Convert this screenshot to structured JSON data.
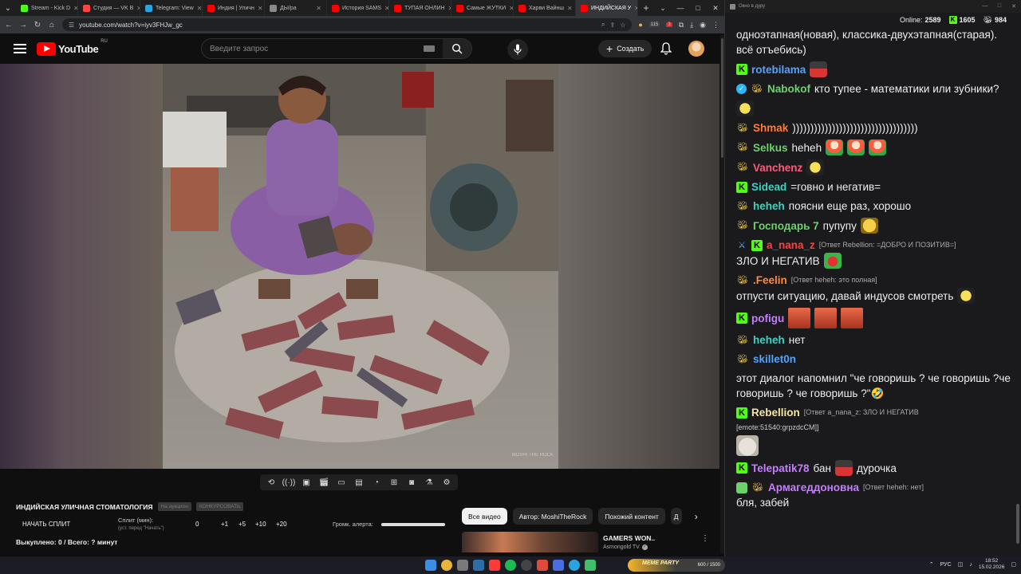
{
  "browser": {
    "tabs": [
      {
        "title": "Stream - Kick D",
        "color": "#53fc18"
      },
      {
        "title": "Студия — VK В",
        "color": "#ff4444"
      },
      {
        "title": "Telegram: View",
        "color": "#2aa3e0"
      },
      {
        "title": "Индия | Уличн",
        "color": "#ff0000"
      },
      {
        "title": "ДЫ/pa",
        "color": "#8a8a8a"
      },
      {
        "title": "История SAMS",
        "color": "#ff0000"
      },
      {
        "title": "ТУПАЯ ОНЛИН",
        "color": "#ff0000"
      },
      {
        "title": "Самые ЖУТКИ",
        "color": "#ff0000"
      },
      {
        "title": "Харви Вайнш",
        "color": "#ff0000"
      },
      {
        "title": "ИНДИЙСКАЯ У",
        "color": "#ff0000"
      }
    ],
    "url": "youtube.com/watch?v=iyv3FHJw_gc",
    "ext_badge_1": "115",
    "ext_badge_2": "3"
  },
  "youtube": {
    "logo_word": "YouTube",
    "country": "RU",
    "search_placeholder": "Введите запрос",
    "create_label": "Создать"
  },
  "video": {
    "watermark": "MOSHI\nTHE ROCK"
  },
  "split": {
    "title": "ИНДИЙСКАЯ УЛИЧНАЯ СТОМАТОЛОГИЯ",
    "chip1": "На аукцион",
    "chip2": "КОНКУРСОВАТЬ",
    "start_label": "НАЧАТЬ СПЛИТ",
    "split_label": "Сплит (мин):",
    "split_sub": "(уст. перед \"Начать\")",
    "value": "0",
    "increments": [
      "+1",
      "+5",
      "+10",
      "+20"
    ],
    "alert_label": "Громк. алерта:",
    "alert_volume": 1.0,
    "bought": "Выкуплено: 0 / Всего: ? минут"
  },
  "filters": [
    "Все видео",
    "Автор: MoshiTheRock",
    "Похожий контент",
    "Д"
  ],
  "recommendation": {
    "title": "GAMERS WON..",
    "channel": "Asmongold TV"
  },
  "chat": {
    "window_title": "Окно в дуру",
    "online_label": "Online:",
    "online_count": "2589",
    "kick_count": "1605",
    "bee_count": "984",
    "messages": [
      {
        "badges": [],
        "user": "",
        "color": "#eee",
        "text": "одноэтапная(новая), классика-двухэтапная(старая). всё отъебись)",
        "emotes": []
      },
      {
        "badges": [
          "k"
        ],
        "user": "rotebilama",
        "color": "#53a3ff",
        "text": "",
        "emotes": [
          "cap"
        ]
      },
      {
        "badges": [
          "check",
          "bee"
        ],
        "user": "Nabokof",
        "color": "#6cd26c",
        "text": "кто тупее - математики или зубники?",
        "emotes": [
          "bee"
        ]
      },
      {
        "badges": [
          "bee"
        ],
        "user": "Shmak",
        "color": "#ff7a3c",
        "text": ")))))))))))))))))))))))))))))))))))",
        "emotes": []
      },
      {
        "badges": [
          "bee"
        ],
        "user": "Selkus",
        "color": "#6cd26c",
        "text": "heheh",
        "emotes": [
          "clown",
          "clown",
          "clown"
        ]
      },
      {
        "badges": [
          "bee"
        ],
        "user": "Vanchenz",
        "color": "#ff5a7a",
        "text": "",
        "emotes": [
          "bee"
        ]
      },
      {
        "badges": [
          "k"
        ],
        "user": "Sidead",
        "color": "#3fd0c0",
        "text": "=говно и негатив=",
        "emotes": []
      },
      {
        "badges": [
          "bee"
        ],
        "user": "heheh",
        "color": "#3fd0c0",
        "text": "поясни еще раз, хорошо",
        "emotes": []
      },
      {
        "badges": [
          "bee"
        ],
        "user": "Господарь 7",
        "color": "#6cd26c",
        "text": "пупупу",
        "emotes": [
          "laugh"
        ]
      },
      {
        "badges": [
          "sword",
          "k"
        ],
        "user": "a_nana_z",
        "color": "#ff4040",
        "reply": "[Ответ Rebellion: =ДОБРО И ПОЗИТИВ=]",
        "text": "ЗЛО И НЕГАТИВ",
        "emotes": [
          "frog"
        ]
      },
      {
        "badges": [
          "bee"
        ],
        "user": ".Feelin",
        "color": "#ff8a3c",
        "reply": "[Ответ heheh: это полная]",
        "text": "отпусти ситуацию, давай индусов смотреть",
        "emotes": [
          "bee"
        ]
      },
      {
        "badges": [
          "k"
        ],
        "user": "pofigu",
        "color": "#c77dff",
        "text": "",
        "emotes": [
          "face",
          "face",
          "face"
        ]
      },
      {
        "badges": [
          "bee"
        ],
        "user": "heheh",
        "color": "#3fd0c0",
        "text": "нет",
        "emotes": []
      },
      {
        "badges": [
          "bee"
        ],
        "user": "skillet0n",
        "color": "#53a3ff",
        "text": "этот диалог напомнил \"че говоришь ? че говоришь ?че говоришь ? че говоришь ?\"🤣",
        "emotes": []
      },
      {
        "badges": [
          "k"
        ],
        "user": "Rebellion",
        "color": "#f5e6a0",
        "reply": "[Ответ a_nana_z: ЗЛО И НЕГАТИВ",
        "sub": "[emote:51540:grpzdcCM]]",
        "text": "",
        "emotes": [
          "cat"
        ]
      },
      {
        "badges": [
          "k"
        ],
        "user": "Telepatik78",
        "color": "#c77dff",
        "text": "бан",
        "emotes": [
          "cap"
        ],
        "text2": "дурочка"
      },
      {
        "badges": [
          "shield",
          "bee"
        ],
        "user": "Армагеддоновна",
        "color": "#c77dff",
        "reply": "[Ответ heheh: нет]",
        "text": "бля, забей",
        "emotes": []
      }
    ]
  },
  "taskbar": {
    "ad_text": "MEME PARTY",
    "ad_progress": "600 / 1500",
    "lang": "РУС",
    "time": "18:52",
    "date": "15.02.2026"
  }
}
